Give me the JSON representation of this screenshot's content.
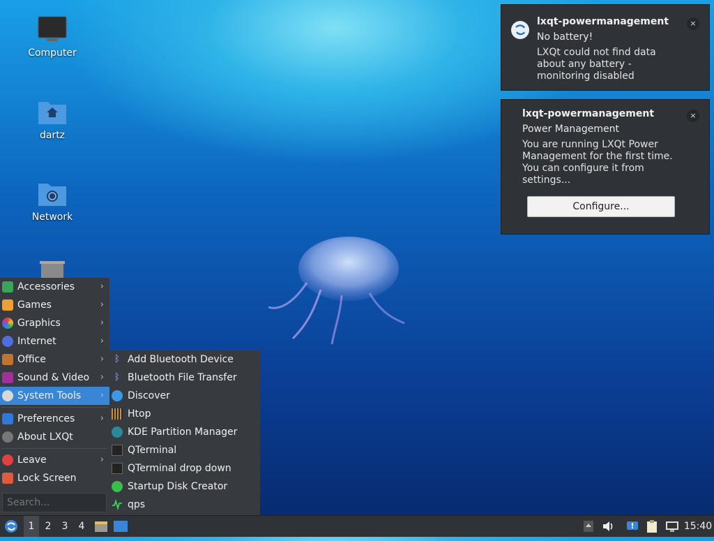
{
  "desktop": {
    "icons": [
      {
        "label": "Computer"
      },
      {
        "label": "dartz"
      },
      {
        "label": "Network"
      },
      {
        "label": "Trash"
      }
    ]
  },
  "notifications": [
    {
      "app": "lxqt-powermanagement",
      "summary": "No battery!",
      "body": "LXQt could not find data about any battery - monitoring disabled",
      "close": "×"
    },
    {
      "app": "lxqt-powermanagement",
      "summary": "Power Management",
      "body": "You are running LXQt Power Management for the first time. You can configure it from settings...",
      "action": "Configure...",
      "close": "×"
    }
  ],
  "menu": {
    "items": [
      {
        "label": "Accessories",
        "icon": "accessories-icon",
        "submenu": true
      },
      {
        "label": "Games",
        "icon": "games-icon",
        "submenu": true
      },
      {
        "label": "Graphics",
        "icon": "graphics-icon",
        "submenu": true
      },
      {
        "label": "Internet",
        "icon": "internet-icon",
        "submenu": true
      },
      {
        "label": "Office",
        "icon": "office-icon",
        "submenu": true
      },
      {
        "label": "Sound & Video",
        "icon": "sound-video-icon",
        "submenu": true
      },
      {
        "label": "System Tools",
        "icon": "system-tools-icon",
        "submenu": true,
        "selected": true
      },
      {
        "label": "Preferences",
        "icon": "preferences-icon",
        "submenu": true
      },
      {
        "label": "About LXQt",
        "icon": "info-icon",
        "submenu": false
      },
      {
        "label": "Leave",
        "icon": "power-icon",
        "submenu": true
      },
      {
        "label": "Lock Screen",
        "icon": "lock-icon",
        "submenu": false
      }
    ],
    "search_placeholder": "Search...",
    "arrow": "›"
  },
  "submenu": {
    "items": [
      {
        "label": "Add Bluetooth Device",
        "icon": "bluetooth-icon"
      },
      {
        "label": "Bluetooth File Transfer",
        "icon": "bluetooth-icon"
      },
      {
        "label": "Discover",
        "icon": "discover-icon"
      },
      {
        "label": "Htop",
        "icon": "htop-icon"
      },
      {
        "label": "KDE Partition Manager",
        "icon": "partition-manager-icon"
      },
      {
        "label": "QTerminal",
        "icon": "terminal-icon"
      },
      {
        "label": "QTerminal drop down",
        "icon": "terminal-icon"
      },
      {
        "label": "Startup Disk Creator",
        "icon": "startup-disk-icon"
      },
      {
        "label": "qps",
        "icon": "qps-icon"
      }
    ]
  },
  "taskbar": {
    "workspaces": [
      "1",
      "2",
      "3",
      "4"
    ],
    "active_workspace": "1",
    "clock": "15:40"
  },
  "colors": {
    "menu_bg": "#373b40",
    "selection": "#3a86d6",
    "panel_bg": "#2f3237"
  }
}
